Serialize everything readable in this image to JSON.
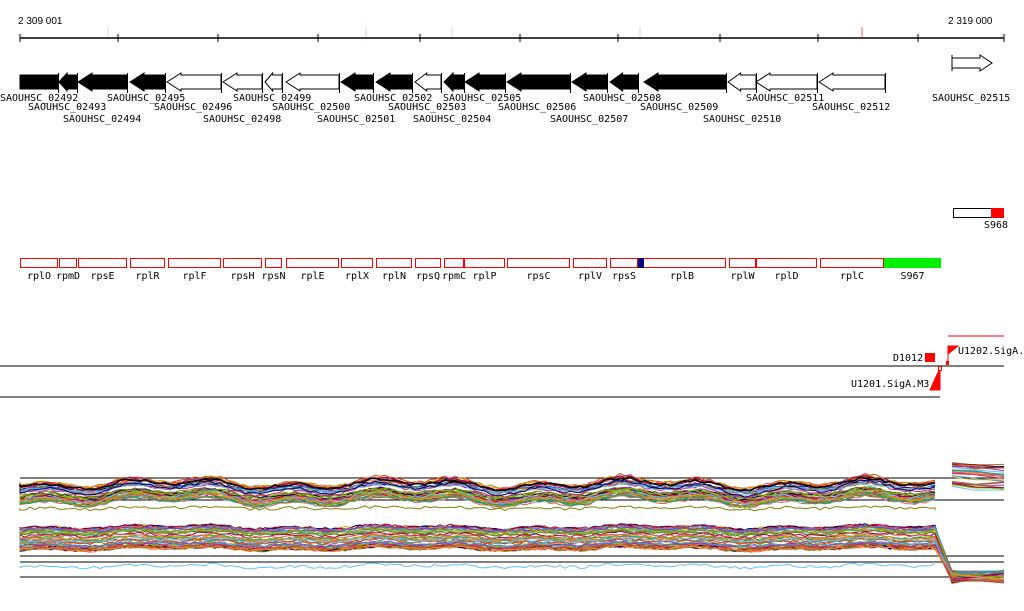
{
  "ruler": {
    "start": "2 309 001",
    "end": "2 319 000"
  },
  "genes": [
    {
      "name": "SAOUHSC_02492",
      "strand": "-",
      "filled": true
    },
    {
      "name": "SAOUHSC_02493",
      "strand": "-",
      "filled": true
    },
    {
      "name": "SAOUHSC_02494",
      "strand": "-",
      "filled": true
    },
    {
      "name": "SAOUHSC_02495",
      "strand": "-",
      "filled": true
    },
    {
      "name": "SAOUHSC_02496",
      "strand": "-",
      "filled": false
    },
    {
      "name": "SAOUHSC_02498",
      "strand": "-",
      "filled": false
    },
    {
      "name": "SAOUHSC_02499",
      "strand": "-",
      "filled": false
    },
    {
      "name": "SAOUHSC_02500",
      "strand": "-",
      "filled": false
    },
    {
      "name": "SAOUHSC_02501",
      "strand": "-",
      "filled": true
    },
    {
      "name": "SAOUHSC_02502",
      "strand": "-",
      "filled": true
    },
    {
      "name": "SAOUHSC_02503",
      "strand": "-",
      "filled": false
    },
    {
      "name": "SAOUHSC_02504",
      "strand": "-",
      "filled": true
    },
    {
      "name": "SAOUHSC_02505",
      "strand": "-",
      "filled": true
    },
    {
      "name": "SAOUHSC_02506",
      "strand": "-",
      "filled": true
    },
    {
      "name": "SAOUHSC_02507",
      "strand": "-",
      "filled": true
    },
    {
      "name": "SAOUHSC_02508",
      "strand": "-",
      "filled": true
    },
    {
      "name": "SAOUHSC_02509",
      "strand": "-",
      "filled": true
    },
    {
      "name": "SAOUHSC_02510",
      "strand": "-",
      "filled": false
    },
    {
      "name": "SAOUHSC_02511",
      "strand": "-",
      "filled": false
    },
    {
      "name": "SAOUHSC_02512",
      "strand": "-",
      "filled": false
    },
    {
      "name": "SAOUHSC_02515",
      "strand": "+",
      "filled": false
    }
  ],
  "s968": {
    "label": "S968"
  },
  "operon": [
    {
      "name": "rplO"
    },
    {
      "name": "rpmD"
    },
    {
      "name": "rpsE"
    },
    {
      "name": "rplR"
    },
    {
      "name": "rplF"
    },
    {
      "name": "rpsH"
    },
    {
      "name": "rpsN"
    },
    {
      "name": "rplE"
    },
    {
      "name": "rplX"
    },
    {
      "name": "rplN"
    },
    {
      "name": "rpsQ"
    },
    {
      "name": "rpmC"
    },
    {
      "name": "rplP"
    },
    {
      "name": "rpsC"
    },
    {
      "name": "rplV"
    },
    {
      "name": "rpsS"
    },
    {
      "name": "rplB"
    },
    {
      "name": "rplW"
    },
    {
      "name": "rplD"
    },
    {
      "name": "rplC"
    },
    {
      "name": "S967"
    }
  ],
  "features": {
    "d1012": "D1012",
    "u1202": "U1202.SigA.",
    "u1201": "U1201.SigA.M3"
  },
  "colors": {
    "red": "#ff0000",
    "green": "#00ee00",
    "navy": "#000080",
    "black": "#000000"
  }
}
